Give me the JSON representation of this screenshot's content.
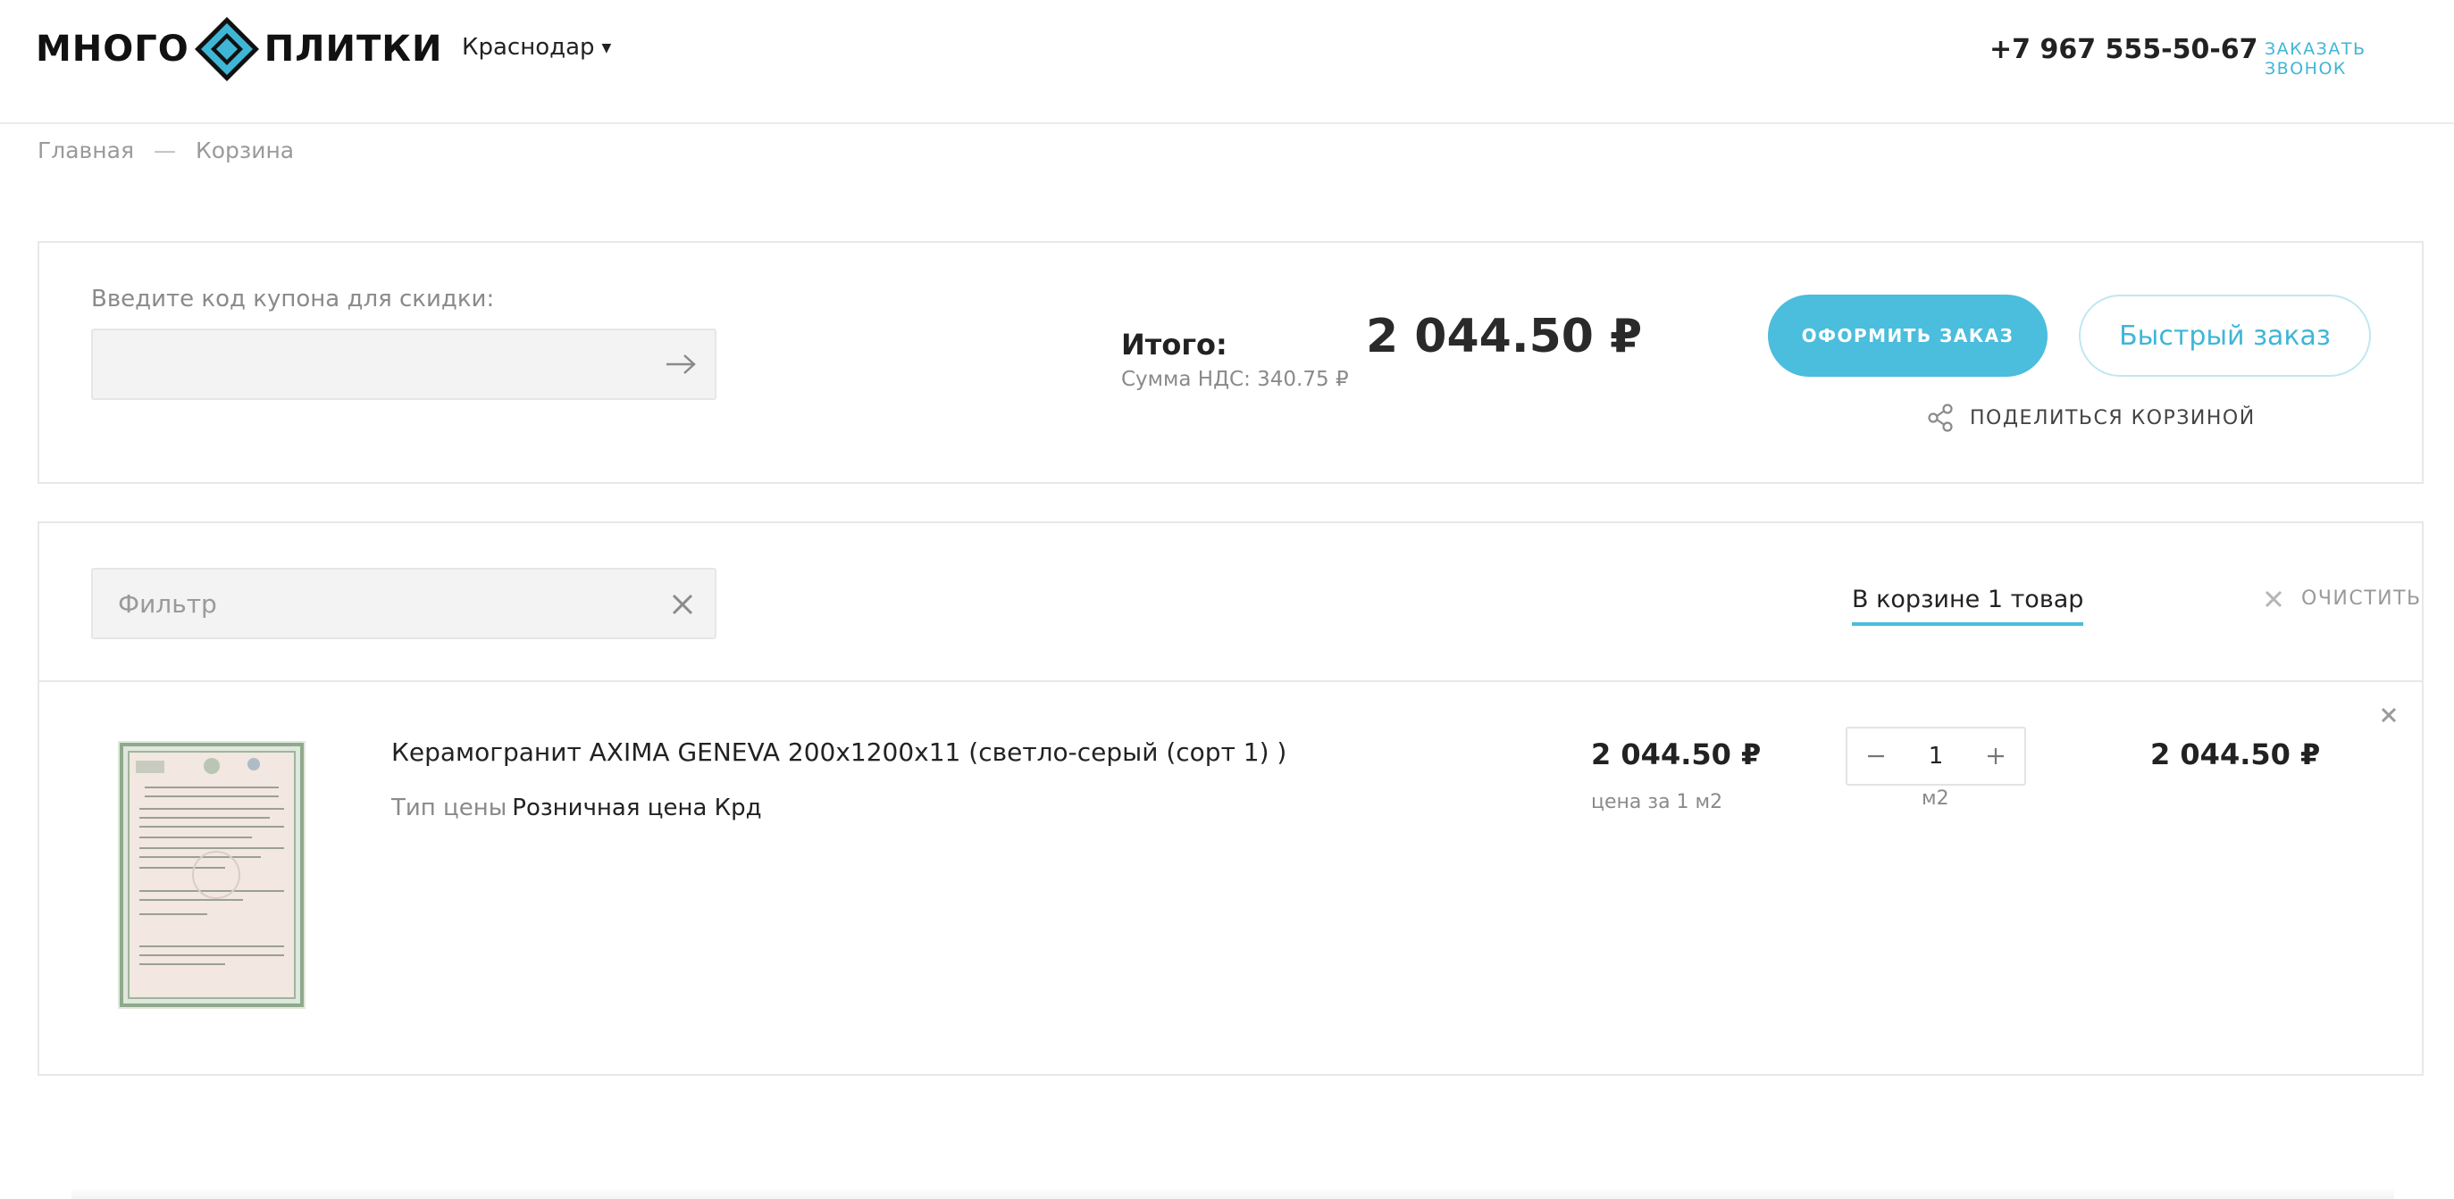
{
  "header": {
    "logo_left": "МНОГО",
    "logo_right": "ПЛИТКИ",
    "city": "Краснодар",
    "phone": "+7 967 555-50-67",
    "callback_label": "ЗАКАЗАТЬ ЗВОНОК"
  },
  "breadcrumb": {
    "home": "Главная",
    "separator": "—",
    "current": "Корзина"
  },
  "summary": {
    "coupon_label": "Введите код купона для скидки:",
    "coupon_value": "",
    "total_label": "Итого:",
    "vat_text": "Сумма НДС: 340.75 ₽",
    "total_value": "2 044.50 ₽",
    "order_button": "ОФОРМИТЬ ЗАКАЗ",
    "quick_order_button": "Быстрый заказ",
    "share_label": "ПОДЕЛИТЬСЯ КОРЗИНОЙ"
  },
  "cart": {
    "filter_placeholder": "Фильтр",
    "count_label": "В корзине 1 товар",
    "clear_label": "ОЧИСТИТЬ",
    "items": [
      {
        "name": "Керамогранит AXIMA GENEVA 200x1200x11 (светло-серый (сорт 1) )",
        "price_type_label": "Тип цены",
        "price_type_value": "Розничная цена Крд",
        "unit_price": "2 044.50 ₽",
        "unit_price_note": "цена за 1 м2",
        "quantity": "1",
        "quantity_unit": "м2",
        "line_total": "2 044.50 ₽"
      }
    ]
  },
  "colors": {
    "accent": "#4bbddd",
    "accent_light": "#bfe7f2",
    "logo_diamond": "#3fb6d6"
  },
  "icons": {
    "arrow": "arrow-right-icon",
    "clear": "close-icon",
    "share": "share-icon",
    "minus": "minus-icon",
    "plus": "plus-icon"
  }
}
